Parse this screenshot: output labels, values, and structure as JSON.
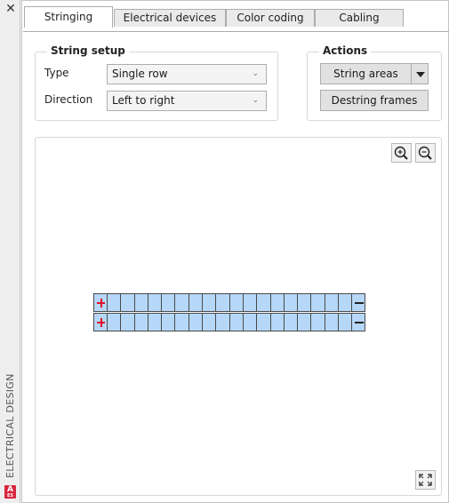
{
  "sidebar": {
    "title": "ELECTRICAL DESIGN",
    "close_icon": "close-icon",
    "logo_letter": "A",
    "logo_caption": "ES"
  },
  "tabs": [
    {
      "label": "Stringing",
      "active": true
    },
    {
      "label": "Electrical devices",
      "active": false
    },
    {
      "label": "Color coding",
      "active": false
    },
    {
      "label": "Cabling",
      "active": false
    }
  ],
  "string_setup": {
    "title": "String setup",
    "type_label": "Type",
    "type_value": "Single row",
    "direction_label": "Direction",
    "direction_value": "Left to right"
  },
  "actions": {
    "title": "Actions",
    "string_areas_label": "String areas",
    "destring_frames_label": "Destring frames"
  },
  "canvas": {
    "zoom_in_icon": "zoom-in-icon",
    "zoom_out_icon": "zoom-out-icon",
    "fit_icon": "fit-to-screen-icon",
    "module_color": "#b6d7f7",
    "plus_color": "#e0102b",
    "rows": 2,
    "modules_per_row": 18
  }
}
